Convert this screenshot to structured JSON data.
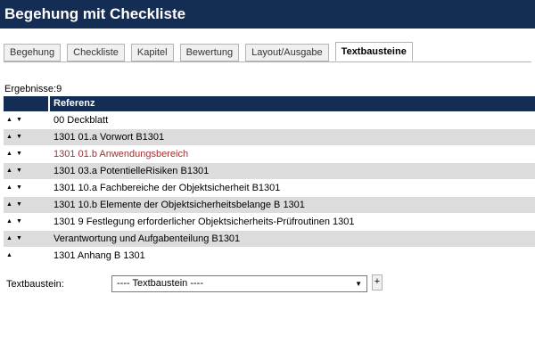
{
  "app": {
    "title": "Begehung mit Checkliste"
  },
  "tabs": [
    {
      "label": "Begehung",
      "active": false
    },
    {
      "label": "Checkliste",
      "active": false
    },
    {
      "label": "Kapitel",
      "active": false
    },
    {
      "label": "Bewertung",
      "active": false
    },
    {
      "label": "Layout/Ausgabe",
      "active": false
    },
    {
      "label": "Textbausteine",
      "active": true
    }
  ],
  "results": {
    "label": "Ergebnisse:9"
  },
  "grid": {
    "column_header": "Referenz",
    "up_icon": "▲",
    "down_icon": "▼",
    "rows": [
      {
        "text": "00 Deckblatt"
      },
      {
        "text": "1301 01.a Vorwort B1301"
      },
      {
        "text": "1301 01.b Anwendungsbereich"
      },
      {
        "text": "1301 03.a PotentielleRisiken B1301"
      },
      {
        "text": "1301 10.a Fachbereiche der Objektsicherheit B1301"
      },
      {
        "text": "1301 10.b Elemente der Objektsicherheitsbelange B 1301"
      },
      {
        "text": "1301 9 Festlegung erforderlicher Objektsicherheits-Prüfroutinen 1301"
      },
      {
        "text": "Verantwortung und Aufgabenteilung B1301"
      },
      {
        "text": "1301 Anhang B 1301"
      }
    ]
  },
  "textbaustein": {
    "label": "Textbaustein:",
    "selected": "---- Textbaustein ----",
    "caret": "▼",
    "add_label": "+"
  },
  "colors": {
    "header_bg": "#142d55",
    "row_alt": "#dcdcdc",
    "highlight_text": "#a03232"
  }
}
